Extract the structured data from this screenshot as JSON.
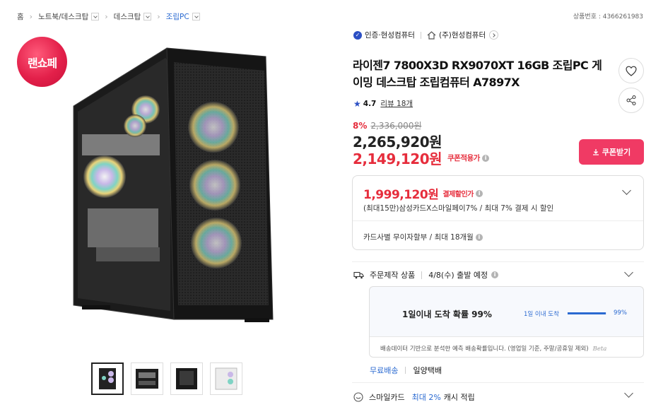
{
  "breadcrumb": [
    "홈",
    "노트북/데스크탑",
    "데스크탑",
    "조립PC"
  ],
  "product_no": "상품번호 : 4366261983",
  "badge": "랜쇼페",
  "seller": {
    "cert_label": "인증·현성컴퓨터",
    "store_name": "(주)현성컴퓨터"
  },
  "title": "라이젠7 7800X3D RX9070XT 16GB 조립PC 게이밍 데스크탑 조립컴퓨터 A7897X",
  "rating": {
    "score": "4.7",
    "reviews": "리뷰 18개"
  },
  "price": {
    "discount_rate": "8%",
    "original": "2,336,000원",
    "sale": "2,265,920원",
    "coupon_price": "2,149,120원",
    "coupon_label": "쿠폰적용가"
  },
  "coupon_button": "쿠폰받기",
  "card_offer": {
    "price": "1,999,120원",
    "label": "결제할인가",
    "desc": "(최대15만)삼성카드X스마일페이7% / 최대 7% 결제 시 할인",
    "installment": "카드사별 무이자할부 / 최대 18개월"
  },
  "shipping": {
    "type": "주문제작 상품",
    "eta": "4/8(수) 출발 예정",
    "probability_text": "1일이내 도착 확률 99%",
    "bar_label": "1일 이내 도착",
    "bar_pct": "99%",
    "bar_fraction": 0.99,
    "note": "배송데이터 기반으로 분석한 예측 배송확률입니다. (영업일 기준, 주말/공휴일 제외)",
    "note_sign": "Beta",
    "free": "무료배송",
    "carrier": "일양택배"
  },
  "smile": {
    "label": "스마일카드",
    "highlight": "최대 2%",
    "suffix": "캐시 적립"
  },
  "colors": {
    "accent_red": "#e62d3c",
    "coupon_pink": "#f03a64",
    "link_blue": "#2b6ad1"
  }
}
